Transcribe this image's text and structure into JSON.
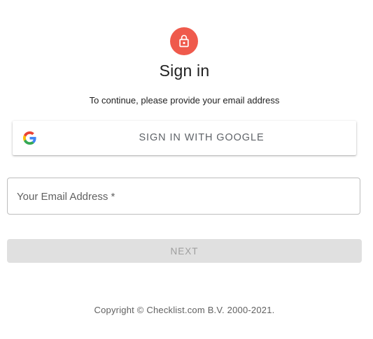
{
  "header": {
    "title": "Sign in",
    "subtitle": "To continue, please provide your email address",
    "accent_color": "#ef5a4c",
    "icon": "lock-icon"
  },
  "google_signin": {
    "label": "SIGN IN WITH GOOGLE",
    "icon": "google-icon"
  },
  "email": {
    "placeholder": "Your Email Address *",
    "value": ""
  },
  "next_button": {
    "label": "NEXT",
    "state": "disabled"
  },
  "footer": {
    "copyright": "Copyright © Checklist.com B.V. 2000-2021."
  }
}
